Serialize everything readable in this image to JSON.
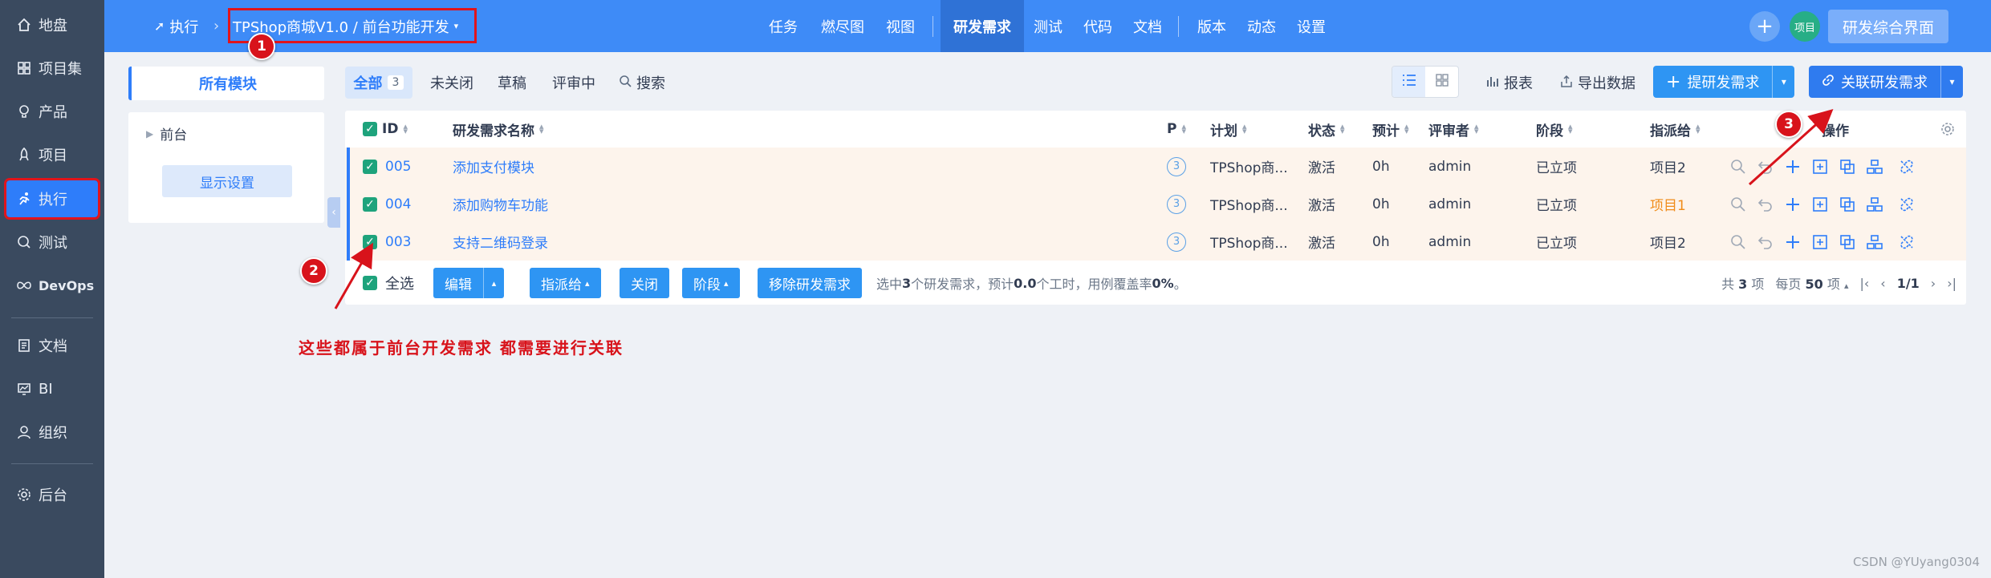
{
  "sidebar": {
    "items": [
      {
        "label": "地盘",
        "icon": "home-icon"
      },
      {
        "label": "项目集",
        "icon": "program-icon"
      },
      {
        "label": "产品",
        "icon": "product-icon"
      },
      {
        "label": "项目",
        "icon": "project-icon"
      },
      {
        "label": "执行",
        "icon": "execution-icon",
        "active": true
      },
      {
        "label": "测试",
        "icon": "test-icon"
      },
      {
        "label": "DevOps",
        "icon": "devops-icon"
      },
      {
        "label": "文档",
        "icon": "doc-icon"
      },
      {
        "label": "BI",
        "icon": "bi-icon"
      },
      {
        "label": "组织",
        "icon": "org-icon"
      },
      {
        "label": "后台",
        "icon": "settings-icon"
      }
    ]
  },
  "topbar": {
    "crumb_root": "执行",
    "crumb_current": "TPShop商城V1.0 / 前台功能开发",
    "nav": [
      "任务",
      "燃尽图",
      "视图",
      "研发需求",
      "测试",
      "代码",
      "文档",
      "版本",
      "动态",
      "设置"
    ],
    "active_nav": "研发需求",
    "avatar_label": "项目",
    "right_button": "研发综合界面"
  },
  "markers": {
    "m1": "1",
    "m2": "2",
    "m3": "3"
  },
  "module_panel": {
    "header": "所有模块",
    "tree_node": "前台",
    "settings_button": "显示设置"
  },
  "feature_bar": {
    "tab_all": "全部",
    "tab_all_count": "3",
    "tabs": [
      "未关闭",
      "草稿",
      "评审中"
    ],
    "search": "搜索",
    "report": "报表",
    "export": "导出数据",
    "create_button": "提研发需求",
    "link_button": "关联研发需求"
  },
  "table": {
    "headers": {
      "id": "ID",
      "name": "研发需求名称",
      "pri": "P",
      "plan": "计划",
      "status": "状态",
      "estimate": "预计",
      "reviewer": "评审者",
      "stage": "阶段",
      "assigned": "指派给",
      "actions": "操作"
    },
    "rows": [
      {
        "id": "005",
        "name": "添加支付模块",
        "pri": "3",
        "plan": "TPShop商...",
        "status": "激活",
        "estimate": "0h",
        "reviewer": "admin",
        "stage": "已立项",
        "assigned": "项目2"
      },
      {
        "id": "004",
        "name": "添加购物车功能",
        "pri": "3",
        "plan": "TPShop商...",
        "status": "激活",
        "estimate": "0h",
        "reviewer": "admin",
        "stage": "已立项",
        "assigned": "项目1"
      },
      {
        "id": "003",
        "name": "支持二维码登录",
        "pri": "3",
        "plan": "TPShop商...",
        "status": "激活",
        "estimate": "0h",
        "reviewer": "admin",
        "stage": "已立项",
        "assigned": "项目2"
      }
    ],
    "footer": {
      "select_all": "全选",
      "buttons": [
        "编辑",
        "指派给",
        "关闭",
        "阶段",
        "移除研发需求"
      ],
      "summary_a": "选中 ",
      "summary_n1": "3",
      "summary_b": " 个研发需求，预计 ",
      "summary_n2": "0.0",
      "summary_c": " 个工时，用例覆盖率 ",
      "summary_n3": "0%",
      "summary_d": "。",
      "total_a": "共 ",
      "total_n": "3",
      "total_b": " 项",
      "per_page_a": "每页 ",
      "per_page_n": "50",
      "per_page_b": " 项",
      "page": "1/1"
    }
  },
  "annotation": "这些都属于前台开发需求 都需要进行关联",
  "watermark": "CSDN @YUyang0304",
  "colors": {
    "primary": "#2e7dfa",
    "topbar": "#3e8bf7",
    "sidebar": "#3a4a5f",
    "marker": "#d8131b",
    "row_highlight": "#fdf4ec"
  }
}
